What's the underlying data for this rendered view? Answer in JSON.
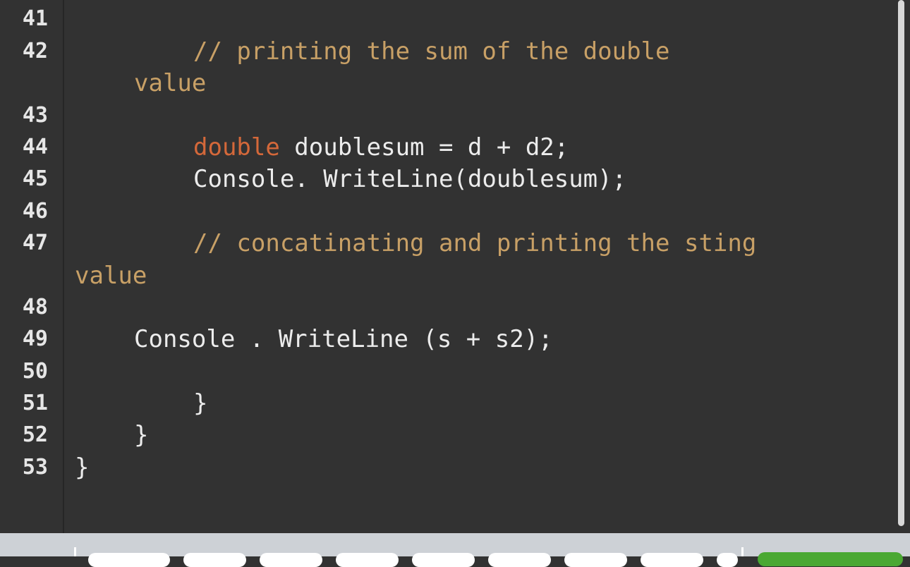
{
  "editor": {
    "lines": [
      {
        "number": "41",
        "code": ""
      },
      {
        "number": "42",
        "comment": "// printing the sum of the double",
        "wrap": "value"
      },
      {
        "number": "43",
        "code": ""
      },
      {
        "number": "44",
        "keyword": "double",
        "rest": " doublesum = d + d2;"
      },
      {
        "number": "45",
        "code": "Console. WriteLine(doublesum);"
      },
      {
        "number": "46",
        "code": ""
      },
      {
        "number": "47",
        "comment": "// concatinating and printing the sting",
        "wrap": "value"
      },
      {
        "number": "48",
        "code": ""
      },
      {
        "number": "49",
        "code": "Console . WriteLine (s + s2);"
      },
      {
        "number": "50",
        "code": ""
      },
      {
        "number": "51",
        "code": "}"
      },
      {
        "number": "52",
        "code": "}"
      },
      {
        "number": "53",
        "code": "}"
      }
    ]
  },
  "colors": {
    "background": "#323232",
    "comment": "#c8a066",
    "keyword": "#d4683a",
    "text": "#ececec",
    "run_button": "#4aa832",
    "toolbar": "#cdd1d6"
  }
}
